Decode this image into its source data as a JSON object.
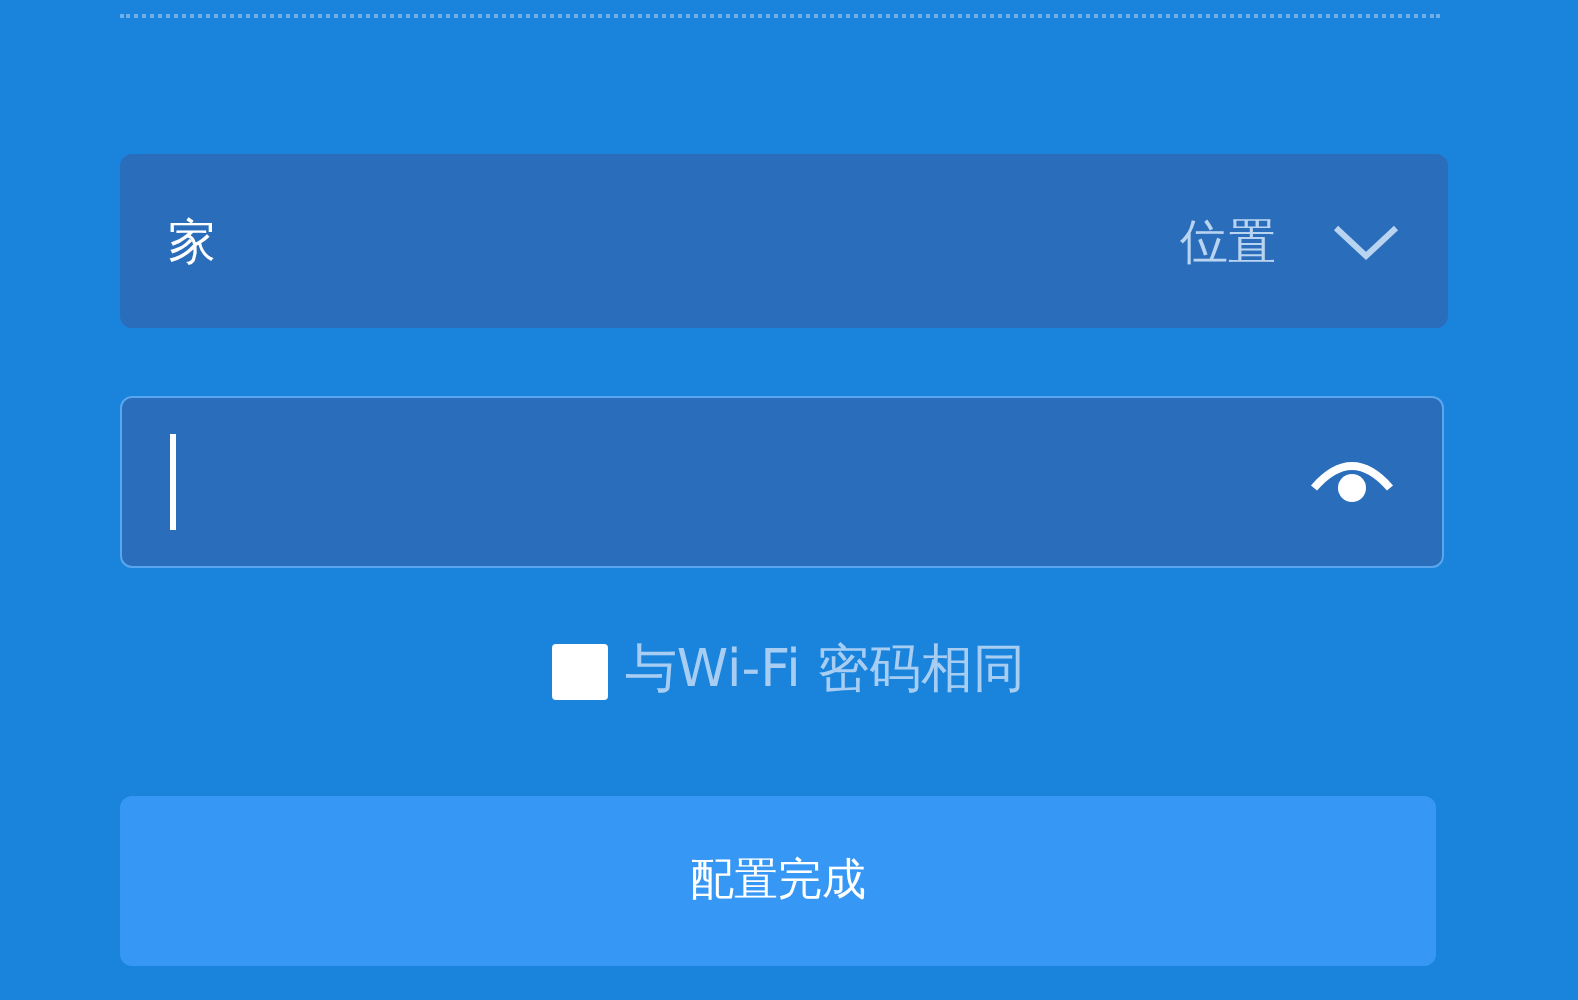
{
  "location_select": {
    "value": "家",
    "label": "位置"
  },
  "password_field": {
    "focused": true
  },
  "same_password_checkbox": {
    "label": "与Wi-Fi 密码相同",
    "checked": false
  },
  "submit_button": {
    "label": "配置完成"
  }
}
